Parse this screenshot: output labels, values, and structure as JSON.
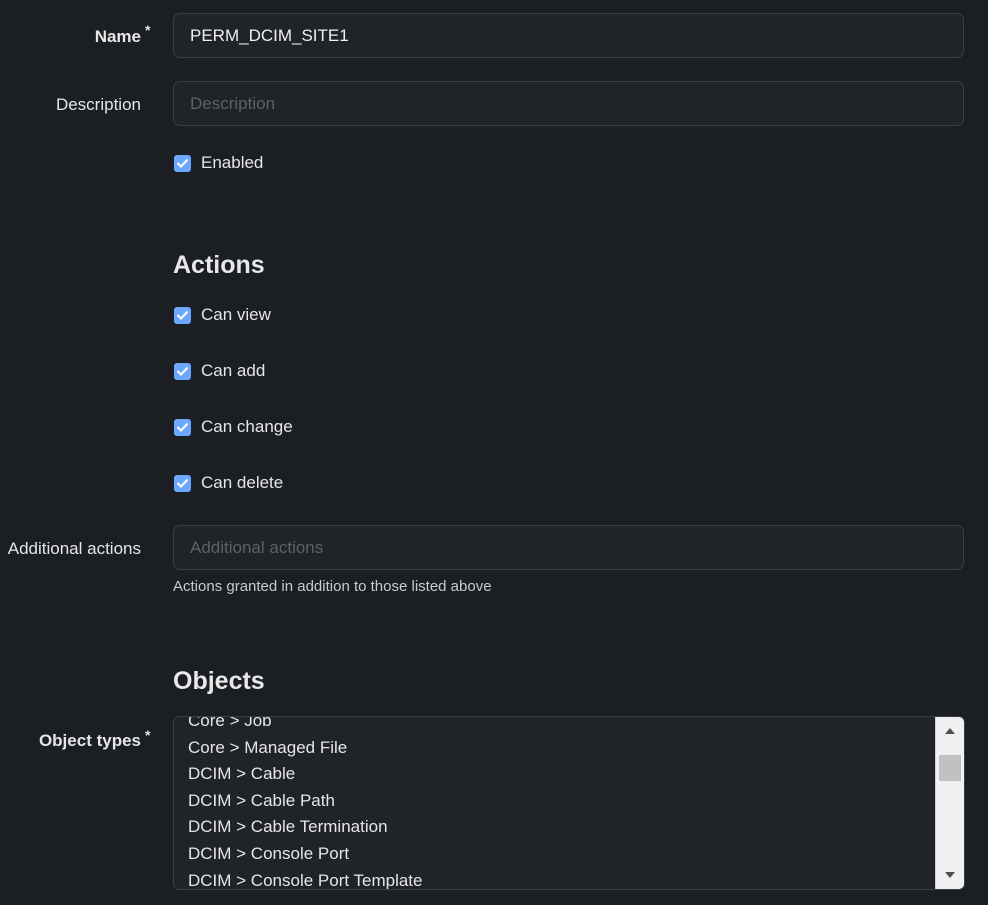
{
  "fields": {
    "name": {
      "label": "Name",
      "required_mark": "*",
      "value": "PERM_DCIM_SITE1"
    },
    "description": {
      "label": "Description",
      "placeholder": "Description",
      "value": ""
    },
    "enabled": {
      "label": "Enabled",
      "checked": true
    }
  },
  "actions": {
    "title": "Actions",
    "items": [
      {
        "label": "Can view",
        "checked": true
      },
      {
        "label": "Can add",
        "checked": true
      },
      {
        "label": "Can change",
        "checked": true
      },
      {
        "label": "Can delete",
        "checked": true
      }
    ],
    "additional": {
      "label": "Additional actions",
      "placeholder": "Additional actions",
      "value": "",
      "help": "Actions granted in addition to those listed above"
    }
  },
  "objects": {
    "title": "Objects",
    "object_types": {
      "label": "Object types",
      "required_mark": "*",
      "options": [
        "Core > Job",
        "Core > Managed File",
        "DCIM > Cable",
        "DCIM > Cable Path",
        "DCIM > Cable Termination",
        "DCIM > Console Port",
        "DCIM > Console Port Template"
      ]
    }
  },
  "colors": {
    "background": "#1b1e22",
    "input_background": "#202327",
    "checkbox_accent": "#6ea8fe"
  }
}
